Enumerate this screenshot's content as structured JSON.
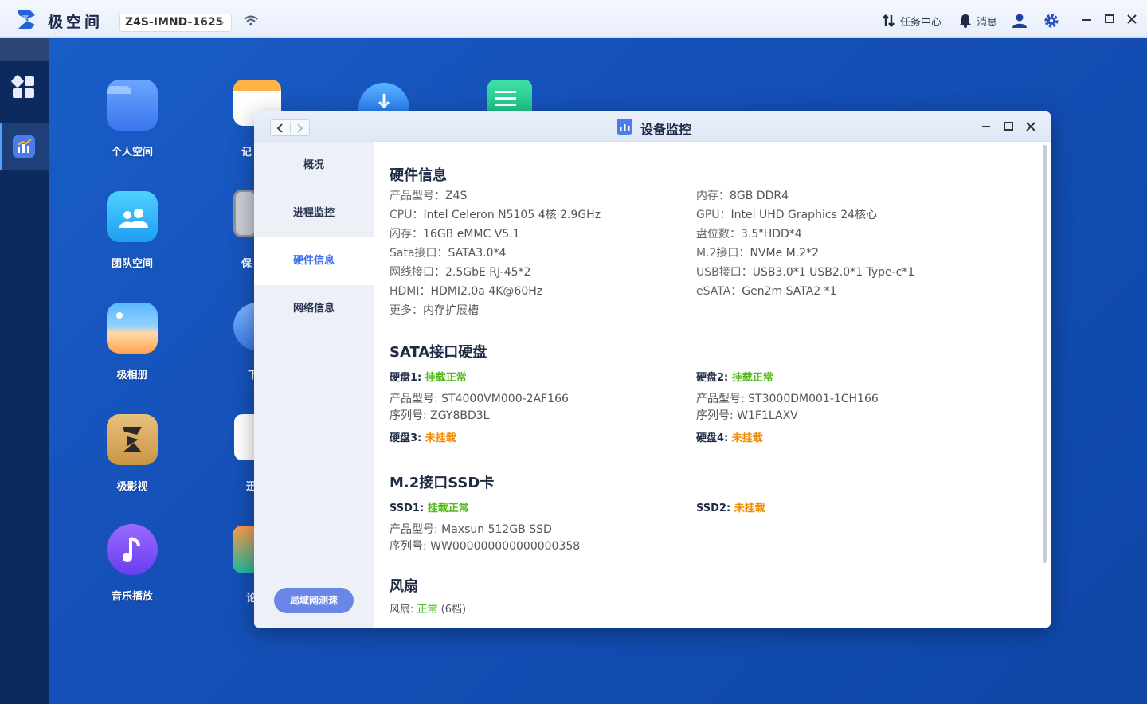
{
  "topbar": {
    "brand": "极空间",
    "device_name": "Z4S-IMND-1625",
    "tasks_label": "任务中心",
    "messages_label": "消息"
  },
  "desktop": {
    "icons": [
      {
        "label": "个人空间",
        "icon": "folder-icon"
      },
      {
        "label": "团队空间",
        "icon": "team-folder-icon"
      },
      {
        "label": "极相册",
        "icon": "photo-album-icon"
      },
      {
        "label": "极影视",
        "icon": "video-icon"
      },
      {
        "label": "音乐播放",
        "icon": "music-icon"
      }
    ],
    "partial_labels": [
      "记",
      "保",
      "下",
      "迅",
      "论"
    ]
  },
  "window": {
    "title": "设备监控",
    "nav": [
      "概况",
      "进程监控",
      "硬件信息",
      "网络信息"
    ],
    "active_nav": "硬件信息",
    "speed_test_button": "局域网测速",
    "hardware": {
      "title": "硬件信息",
      "left": [
        {
          "k": "产品型号：",
          "v": "Z4S"
        },
        {
          "k": "CPU：",
          "v": "Intel Celeron N5105 4核 2.9GHz"
        },
        {
          "k": "闪存：",
          "v": "16GB eMMC V5.1"
        },
        {
          "k": "Sata接口：",
          "v": "SATA3.0*4"
        },
        {
          "k": "网线接口：",
          "v": "2.5GbE RJ-45*2"
        },
        {
          "k": "HDMI：",
          "v": "HDMI2.0a 4K@60Hz"
        },
        {
          "k": "更多：",
          "v": "内存扩展槽"
        }
      ],
      "right": [
        {
          "k": "内存：",
          "v": "8GB DDR4"
        },
        {
          "k": "GPU：",
          "v": "Intel UHD Graphics 24核心"
        },
        {
          "k": "盘位数：",
          "v": "3.5\"HDD*4"
        },
        {
          "k": "M.2接口：",
          "v": "NVMe M.2*2"
        },
        {
          "k": "USB接口：",
          "v": "USB3.0*1 USB2.0*1 Type-c*1"
        },
        {
          "k": "eSATA：",
          "v": "Gen2m SATA2 *1"
        }
      ]
    },
    "sata": {
      "title": "SATA接口硬盘",
      "disk1": {
        "label": "硬盘1: ",
        "status": "挂载正常",
        "model": "产品型号: ST4000VM000-2AF166",
        "serial": "序列号: ZGY8BD3L"
      },
      "disk2": {
        "label": "硬盘2: ",
        "status": "挂载正常",
        "model": "产品型号: ST3000DM001-1CH166",
        "serial": "序列号: W1F1LAXV"
      },
      "disk3": {
        "label": "硬盘3: ",
        "status": "未挂载"
      },
      "disk4": {
        "label": "硬盘4: ",
        "status": "未挂载"
      }
    },
    "m2": {
      "title": "M.2接口SSD卡",
      "ssd1": {
        "label": "SSD1: ",
        "status": "挂载正常",
        "model": "产品型号: Maxsun 512GB SSD",
        "serial": "序列号: WW000000000000000358"
      },
      "ssd2": {
        "label": "SSD2: ",
        "status": "未挂载"
      }
    },
    "fan": {
      "title": "风扇",
      "label": "风扇: ",
      "status": "正常",
      "level": " (6档)"
    }
  },
  "colors": {
    "ok": "#52b81c",
    "warn": "#f08c00",
    "accent": "#3b6ef0"
  }
}
